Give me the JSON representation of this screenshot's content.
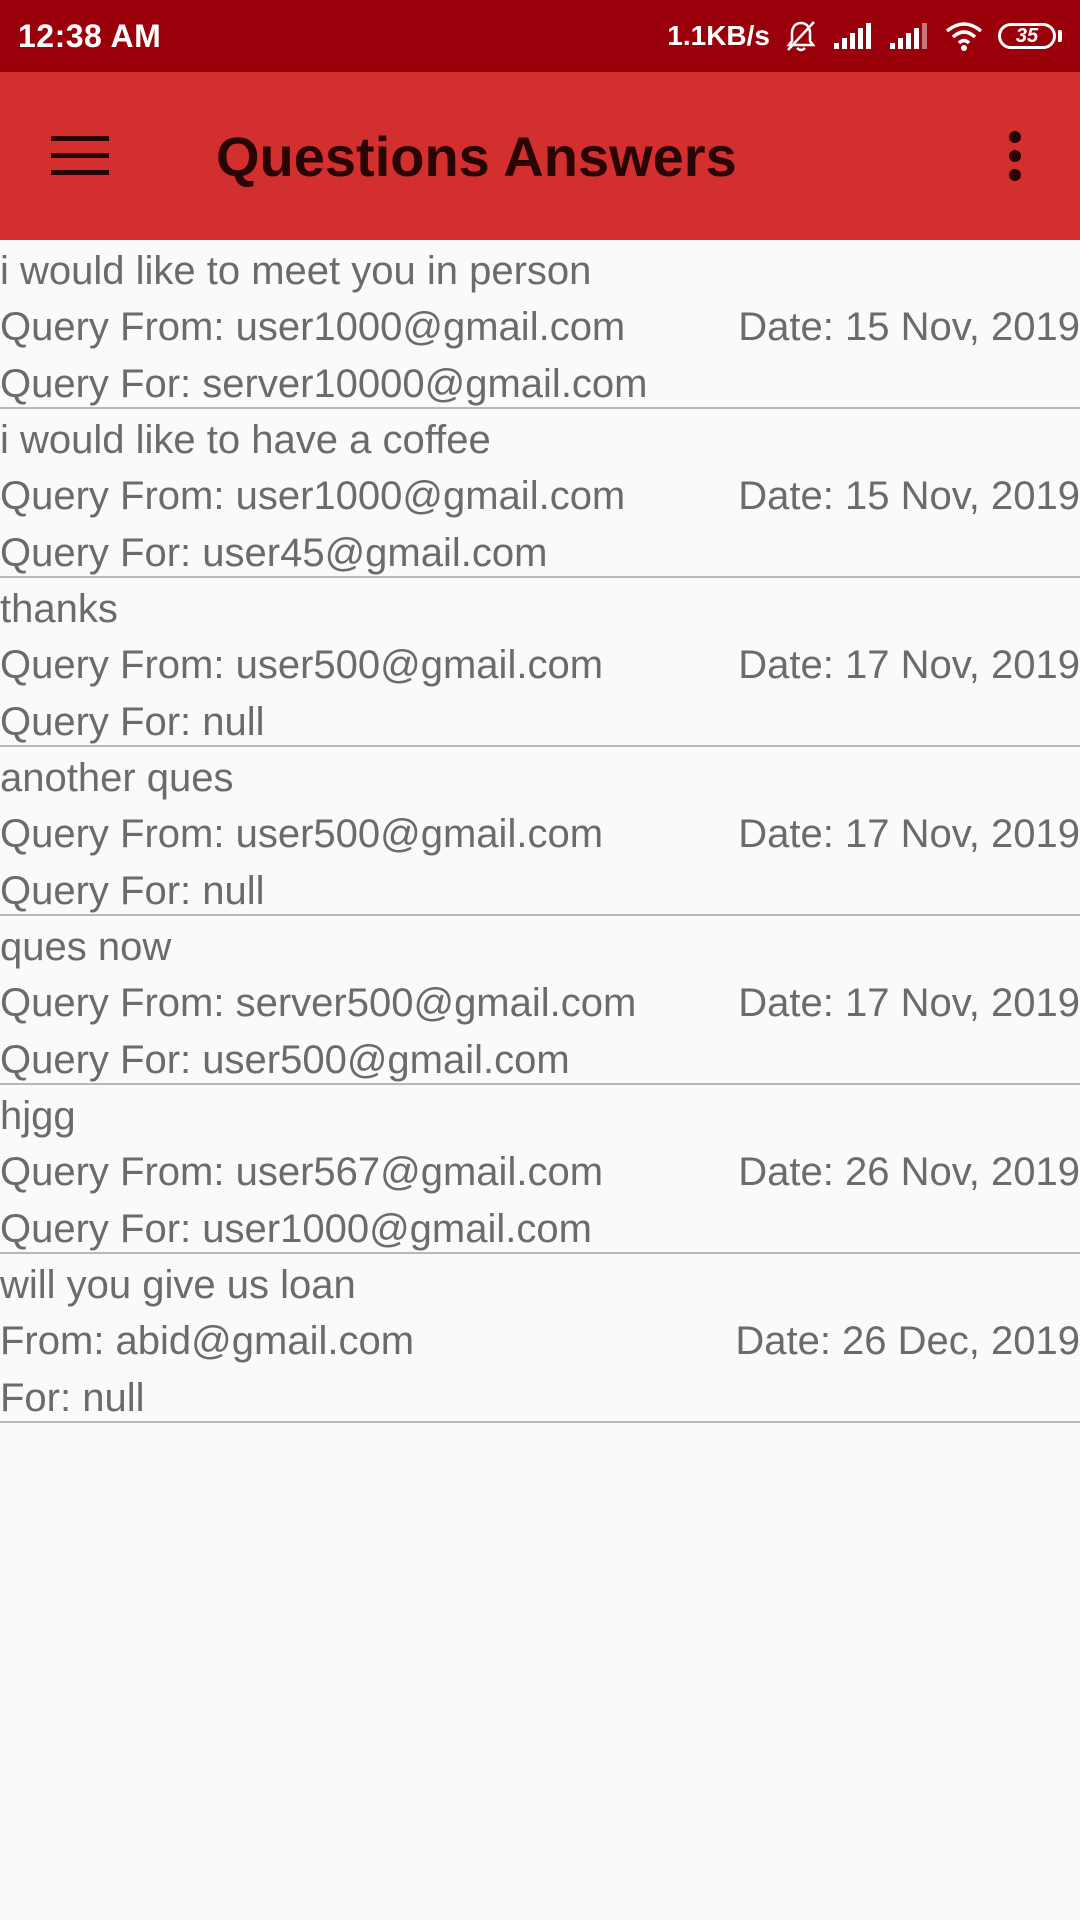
{
  "status_bar": {
    "time": "12:38 AM",
    "network_speed": "1.1KB/s",
    "battery_level": "35",
    "icons": [
      "bell-muted-icon",
      "signal-icon",
      "signal-icon",
      "wifi-icon",
      "battery-icon"
    ]
  },
  "app_bar": {
    "title": "Questions Answers",
    "menu_icon": "hamburger-menu-icon",
    "overflow_icon": "more-vert-icon",
    "background": "#d32f2f",
    "status_background": "#9a000a"
  },
  "queries": [
    {
      "question": "i would like to meet you in person",
      "from": "Query From: user1000@gmail.com",
      "date": "Date: 15 Nov, 2019",
      "for": "Query For: server10000@gmail.com"
    },
    {
      "question": "i would like to have a coffee",
      "from": "Query From: user1000@gmail.com",
      "date": "Date: 15 Nov, 2019",
      "for": "Query For: user45@gmail.com"
    },
    {
      "question": "thanks",
      "from": "Query From: user500@gmail.com",
      "date": "Date: 17 Nov, 2019",
      "for": "Query For: null"
    },
    {
      "question": "another ques",
      "from": "Query From: user500@gmail.com",
      "date": "Date: 17 Nov, 2019",
      "for": "Query For: null"
    },
    {
      "question": "ques now",
      "from": "Query From: server500@gmail.com",
      "date": "Date: 17 Nov, 2019",
      "for": "Query For: user500@gmail.com"
    },
    {
      "question": "hjgg",
      "from": "Query From: user567@gmail.com",
      "date": "Date: 26 Nov, 2019",
      "for": "Query For: user1000@gmail.com"
    },
    {
      "question": "will you give us loan",
      "from": "From: abid@gmail.com",
      "date": "Date: 26 Dec, 2019",
      "for": "For: null"
    }
  ]
}
